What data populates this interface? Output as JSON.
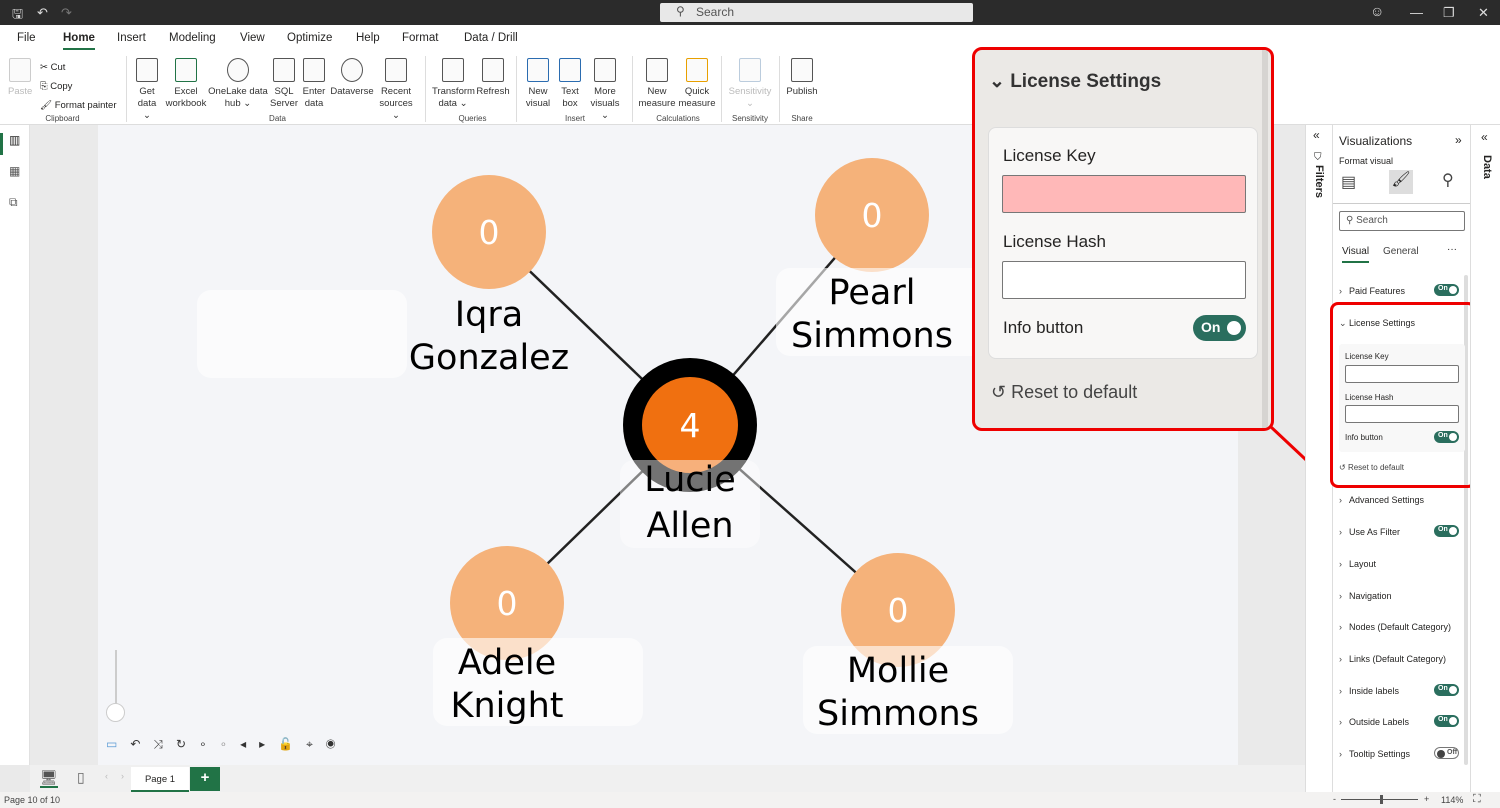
{
  "titlebar": {
    "search_placeholder": "Search"
  },
  "ribbon_tabs": [
    "File",
    "Home",
    "Insert",
    "Modeling",
    "View",
    "Optimize",
    "Help",
    "Format",
    "Data / Drill"
  ],
  "active_tab": "Home",
  "ribbon": {
    "clipboard": {
      "paste": "Paste",
      "cut": "Cut",
      "copy": "Copy",
      "format_painter": "Format painter",
      "group": "Clipboard"
    },
    "data": {
      "items": [
        "Get data ⌄",
        "Excel workbook",
        "OneLake data hub ⌄",
        "SQL Server",
        "Enter data",
        "Dataverse",
        "Recent sources ⌄"
      ],
      "group": "Data"
    },
    "queries": {
      "items": [
        "Transform data ⌄",
        "Refresh"
      ],
      "group": "Queries"
    },
    "insert": {
      "items": [
        "New visual",
        "Text box",
        "More visuals ⌄"
      ],
      "group": "Insert"
    },
    "calculations": {
      "items": [
        "New measure",
        "Quick measure"
      ],
      "group": "Calculations"
    },
    "sensitivity": {
      "items": [
        "Sensitivity ⌄"
      ],
      "group": "Sensitivity"
    },
    "share": {
      "items": [
        "Publish"
      ],
      "group": "Share"
    }
  },
  "graph": {
    "center": {
      "value": "4",
      "label": [
        "Lucie",
        "Allen"
      ]
    },
    "nodes": [
      {
        "value": "0",
        "label": [
          "Iqra",
          "Gonzalez"
        ]
      },
      {
        "value": "0",
        "label": [
          "Pearl",
          "Simmons"
        ]
      },
      {
        "value": "0",
        "label": [
          "Adele",
          "Knight"
        ]
      },
      {
        "value": "0",
        "label": [
          "Mollie",
          "Simmons"
        ]
      }
    ],
    "colors": {
      "center_fill": "#f07010",
      "center_ring": "#000000",
      "node_fill": "#f5b27a"
    }
  },
  "callout": {
    "title": "License Settings",
    "license_key_label": "License Key",
    "license_key_value": "",
    "license_hash_label": "License Hash",
    "license_hash_value": "",
    "info_button_label": "Info button",
    "info_toggle": "On",
    "reset": "Reset to default"
  },
  "filters": {
    "label": "Filters"
  },
  "data_pane": {
    "label": "Data"
  },
  "viz": {
    "title": "Visualizations",
    "subtitle": "Format visual",
    "search_placeholder": "Search",
    "tabs": [
      "Visual",
      "General"
    ],
    "more": "···",
    "sections": [
      {
        "label": "Paid Features",
        "toggle": "On"
      },
      {
        "label": "License Settings",
        "expanded": true
      },
      {
        "label": "Advanced Settings"
      },
      {
        "label": "Use As Filter",
        "toggle": "On"
      },
      {
        "label": "Layout"
      },
      {
        "label": "Navigation"
      },
      {
        "label": "Nodes (Default Category)"
      },
      {
        "label": "Links (Default Category)"
      },
      {
        "label": "Inside labels",
        "toggle": "On"
      },
      {
        "label": "Outside Labels",
        "toggle": "On"
      },
      {
        "label": "Tooltip Settings",
        "toggle": "Off"
      }
    ],
    "license": {
      "key_label": "License Key",
      "hash_label": "License Hash",
      "info_label": "Info button",
      "info_toggle": "On",
      "reset": "Reset to default"
    }
  },
  "pages": {
    "tabs": [
      "Page 1"
    ],
    "add": "+"
  },
  "status": {
    "page": "Page 10 of 10",
    "zoom": "114%",
    "zoom_minus": "-",
    "zoom_plus": "+"
  }
}
